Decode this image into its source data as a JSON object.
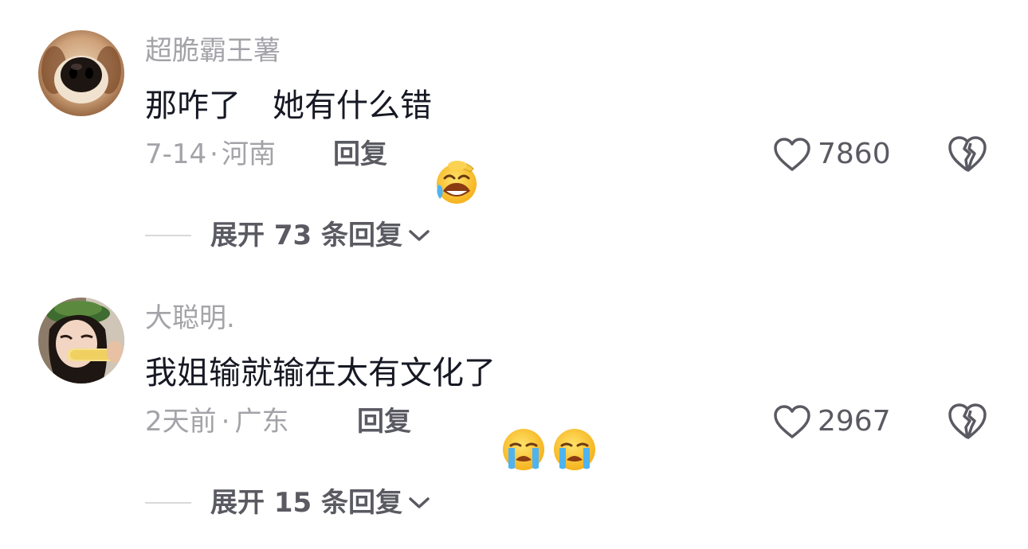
{
  "comments": [
    {
      "username": "超脆霸王薯",
      "text": "那咋了　她有什么错",
      "emojis": [
        "laughing-tears-emoji"
      ],
      "date": "7-14",
      "separator": "·",
      "location": "河南",
      "reply_label": "回复",
      "likes": "7860",
      "expand_label": "展开 73 条回复",
      "avatar": "dog-nose-avatar"
    },
    {
      "username": "大聪明.",
      "text": "我姐输就输在太有文化了",
      "emojis": [
        "crying-emoji",
        "crying-emoji"
      ],
      "date": "2天前",
      "separator": "·",
      "location": "广东",
      "reply_label": "回复",
      "likes": "2967",
      "expand_label": "展开 15 条回复",
      "avatar": "girl-with-corn-avatar"
    }
  ],
  "icons": {
    "like": "heart-outline-icon",
    "dislike": "broken-heart-icon",
    "expand": "chevron-down-icon"
  },
  "colors": {
    "text_primary": "#161823",
    "text_secondary": "#a3a3a8",
    "action": "#5a5a62"
  }
}
